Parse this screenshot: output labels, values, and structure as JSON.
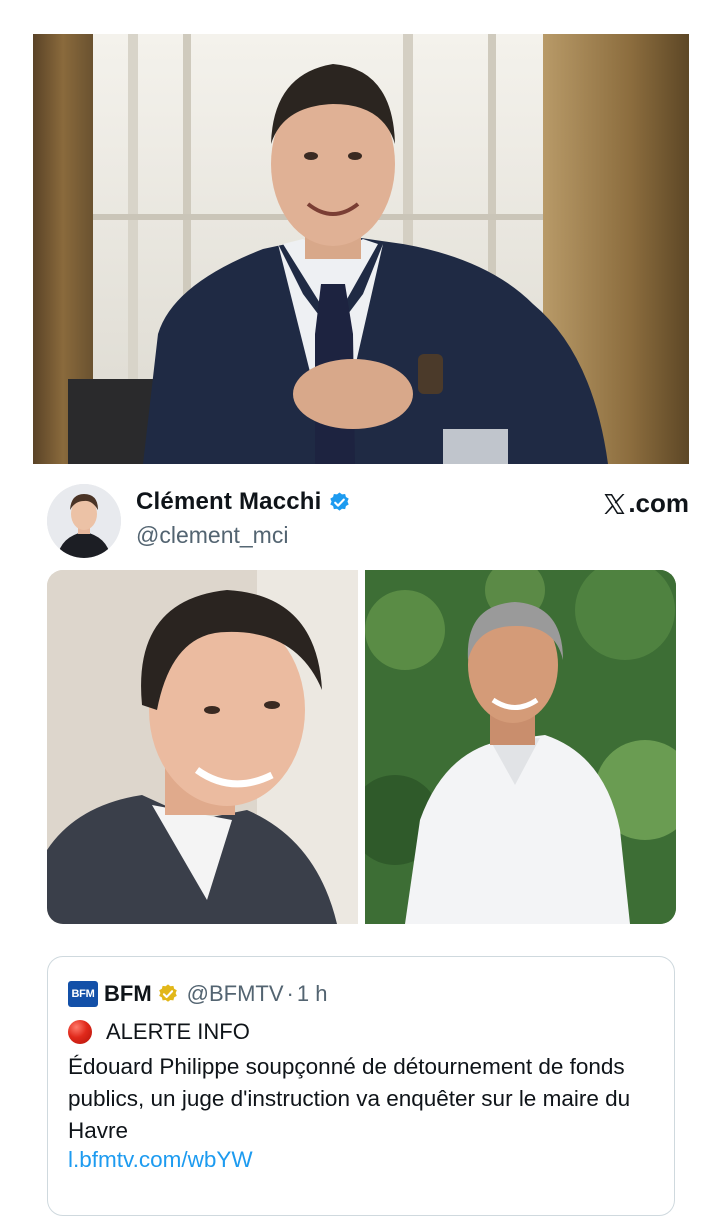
{
  "tweet": {
    "author_name": "Clément Macchi",
    "author_handle": "@clement_mci",
    "source": ".com",
    "source_icon": "x-logo-icon"
  },
  "quoted_tweet": {
    "logo_text": "BFM",
    "author_name": "BFM",
    "author_handle": "@BFMTV",
    "separator": "·",
    "time": "1 h",
    "alert_icon": "red-circle-icon",
    "alert_label": "ALERTE INFO",
    "body": "Édouard Philippe soupçonné de détournement de fonds publics, un juge d'instruction va enquêter sur le maire du Havre",
    "link": "l.bfmtv.com/wbYW"
  },
  "colors": {
    "verified_blue": "#1d9bf0",
    "verified_gold": "#e2b719",
    "link": "#1d9bf0",
    "secondary_text": "#536471",
    "bfm_blue": "#1350a8"
  }
}
